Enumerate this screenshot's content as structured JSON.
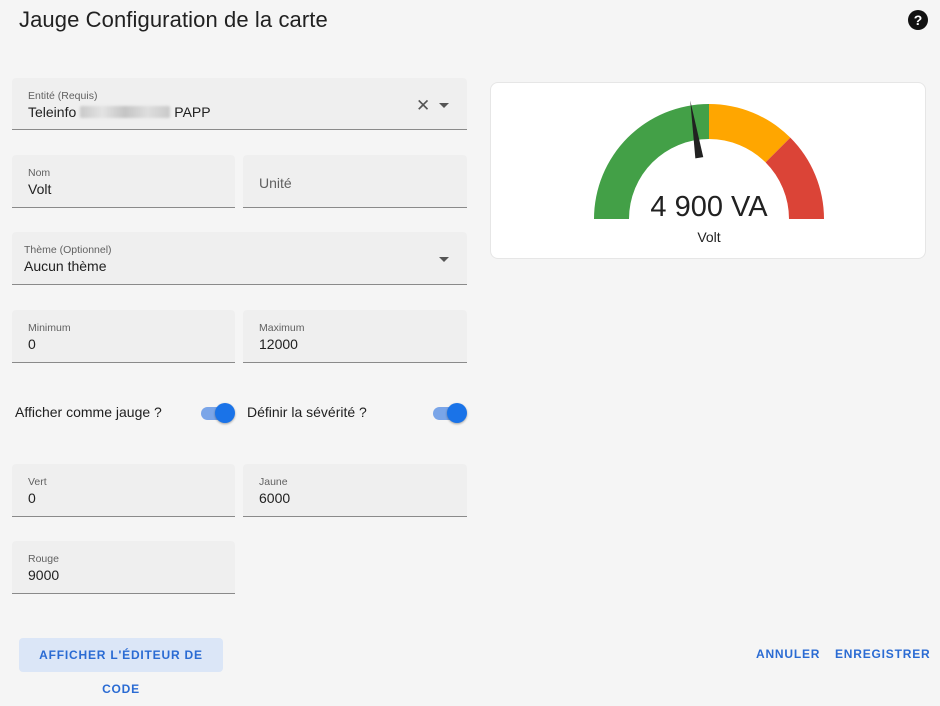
{
  "dialog": {
    "title": "Jauge Configuration de la carte",
    "help_icon": "help-circle-icon"
  },
  "entity": {
    "label": "Entité (Requis)",
    "value_prefix": "Teleinfo",
    "value_suffix": "PAPP",
    "clear_icon": "close-icon",
    "dropdown_icon": "arrow-drop-down-icon"
  },
  "name": {
    "label": "Nom",
    "value": "Volt"
  },
  "unit": {
    "placeholder": "Unité"
  },
  "theme": {
    "label": "Thème (Optionnel)",
    "value": "Aucun thème",
    "dropdown_icon": "arrow-drop-down-icon"
  },
  "minimum": {
    "label": "Minimum",
    "value": "0"
  },
  "maximum": {
    "label": "Maximum",
    "value": "12000"
  },
  "toggles": {
    "show_as_gauge": {
      "label": "Afficher comme jauge ?",
      "checked": true
    },
    "define_severity": {
      "label": "Définir la sévérité ?",
      "checked": true
    }
  },
  "severity": {
    "green": {
      "label": "Vert",
      "value": "0"
    },
    "yellow": {
      "label": "Jaune",
      "value": "6000"
    },
    "red": {
      "label": "Rouge",
      "value": "9000"
    }
  },
  "preview": {
    "value_text": "4 900 VA",
    "name": "Volt",
    "value": 4900,
    "min": 0,
    "max": 12000,
    "needle_value": 5400,
    "colors": {
      "green": "#43a047",
      "yellow": "#ffa600",
      "red": "#db4437",
      "needle": "#212121"
    }
  },
  "actions": {
    "show_code_editor": "AFFICHER L'ÉDITEUR DE CODE",
    "cancel": "ANNULER",
    "save": "ENREGISTRER"
  },
  "accent_color": "#1a73e8"
}
